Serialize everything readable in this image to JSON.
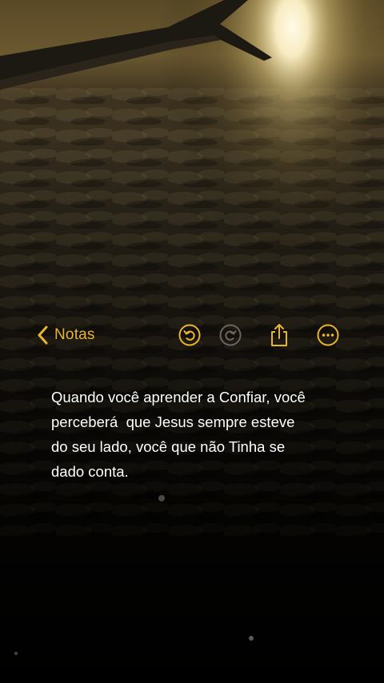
{
  "toolbar": {
    "back_label": "Notas",
    "accent_color": "#e7b62e",
    "icons": {
      "back": "chevron-left-icon",
      "undo": "undo-icon",
      "redo": "redo-icon",
      "share": "share-icon",
      "more": "more-icon"
    }
  },
  "note": {
    "lines": [
      "Quando você aprender a Confiar, você",
      "perceberá  que Jesus sempre esteve",
      "do seu lado, você que não Tinha se",
      "dado conta."
    ]
  }
}
